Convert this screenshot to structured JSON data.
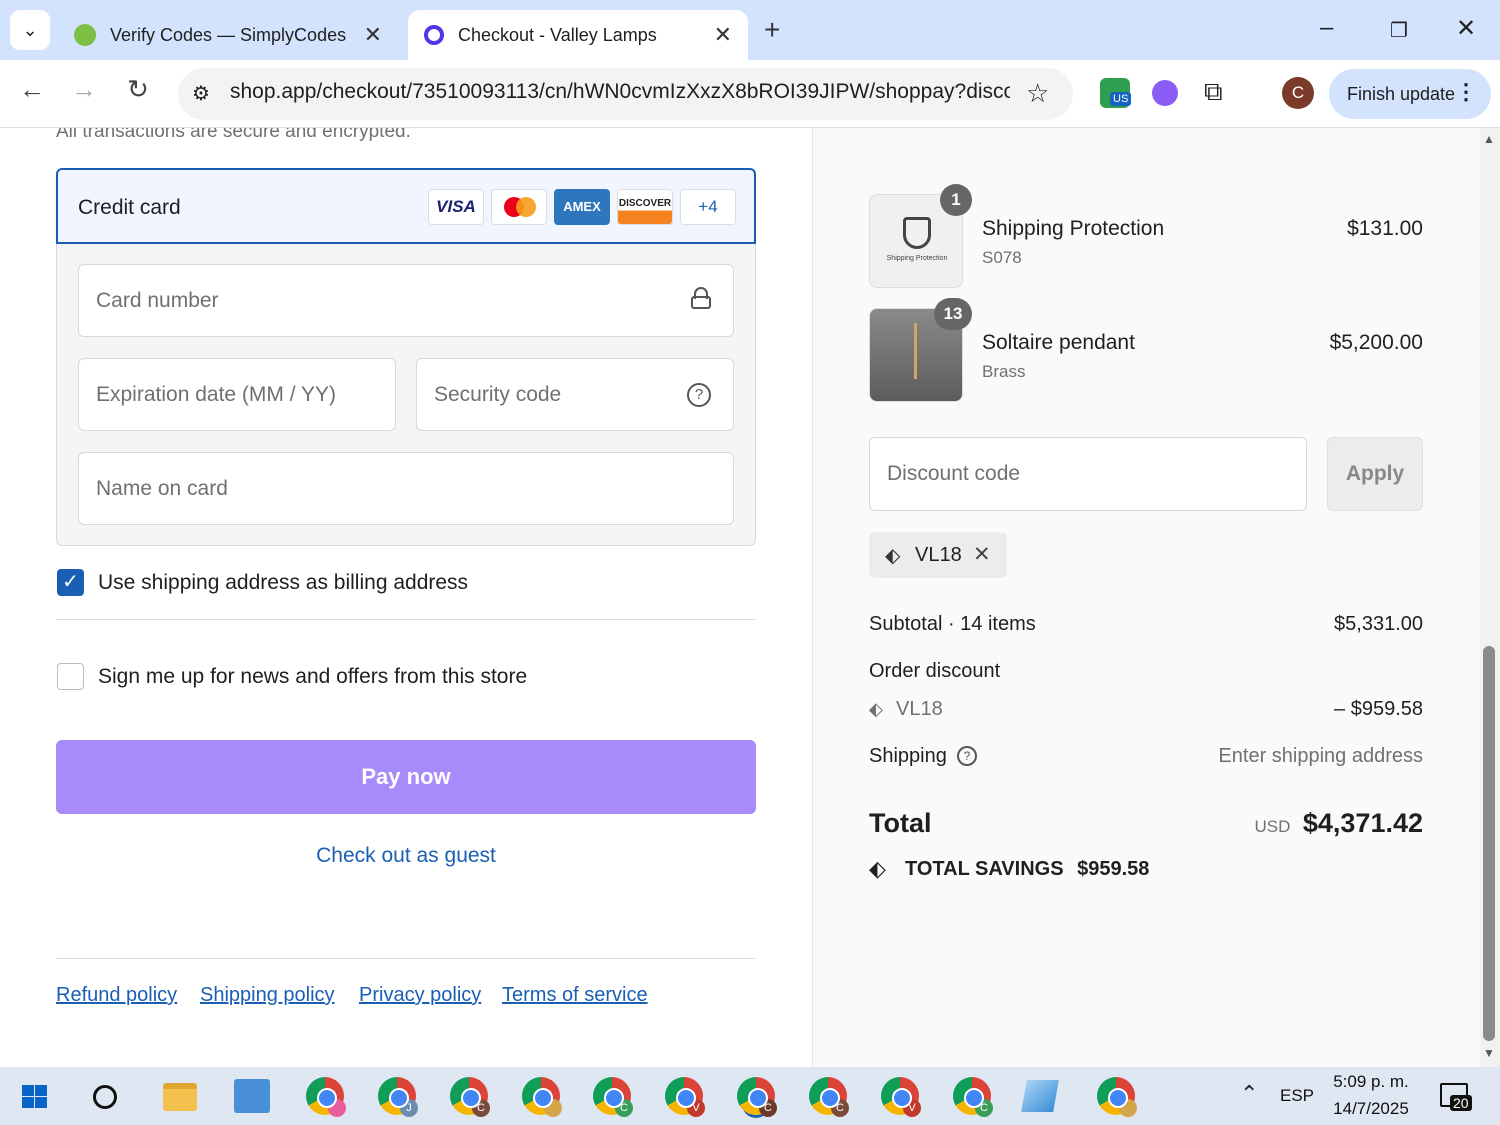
{
  "browser": {
    "tabs": [
      {
        "title": "Verify Codes — SimplyCodes",
        "close": "✕"
      },
      {
        "title": "Checkout - Valley Lamps",
        "close": "✕"
      }
    ],
    "new_tab": "+",
    "url": "shop.app/checkout/73510093113/cn/hWN0cvmIzXxzX8bROI39JIPW/shoppay?disco...",
    "profile_initial": "C",
    "finish_update_label": "Finish update",
    "extension_badge": "US"
  },
  "payment": {
    "secure_note": "All transactions are secure and encrypted.",
    "method_label": "Credit card",
    "card_brands": [
      "VISA",
      "AMEX",
      "DISCOVER"
    ],
    "more_brands": "+4",
    "card_number_placeholder": "Card number",
    "expiration_placeholder": "Expiration date (MM / YY)",
    "security_code_placeholder": "Security code",
    "name_placeholder": "Name on card"
  },
  "options": {
    "billing_same_label": "Use shipping address as billing address",
    "billing_same_checked": true,
    "newsletter_label": "Sign me up for news and offers from this store",
    "newsletter_checked": false
  },
  "actions": {
    "pay_now": "Pay now",
    "guest_checkout": "Check out as guest"
  },
  "footer_links": [
    "Refund policy",
    "Shipping policy",
    "Privacy policy",
    "Terms of service"
  ],
  "order": {
    "items": [
      {
        "quantity": "1",
        "name": "Shipping Protection",
        "variant": "S078",
        "price": "$131.00",
        "thumb_text": "Shipping Protection"
      },
      {
        "quantity": "13",
        "name": "Soltaire pendant",
        "variant": "Brass",
        "price": "$5,200.00"
      }
    ],
    "discount_placeholder": "Discount code",
    "apply_label": "Apply",
    "applied_code": "VL18",
    "subtotal_label": "Subtotal · 14 items",
    "subtotal_value": "$5,331.00",
    "order_discount_label": "Order discount",
    "discount_code": "VL18",
    "discount_value": "– $959.58",
    "shipping_label": "Shipping",
    "shipping_value": "Enter shipping address",
    "total_label": "Total",
    "currency": "USD",
    "total_value": "$4,371.42",
    "savings_label": "TOTAL SAVINGS",
    "savings_value": "$959.58"
  },
  "taskbar": {
    "language": "ESP",
    "time": "5:09 p. m.",
    "date": "14/7/2025",
    "notifications": "20",
    "chrome_badges": [
      "",
      "J",
      "C",
      "",
      "C",
      "V",
      "C",
      "C",
      "V",
      "C",
      ""
    ]
  },
  "colors": {
    "accent": "#5433eb",
    "pay_button": "#a78bfa",
    "link": "#1a5fb4"
  }
}
